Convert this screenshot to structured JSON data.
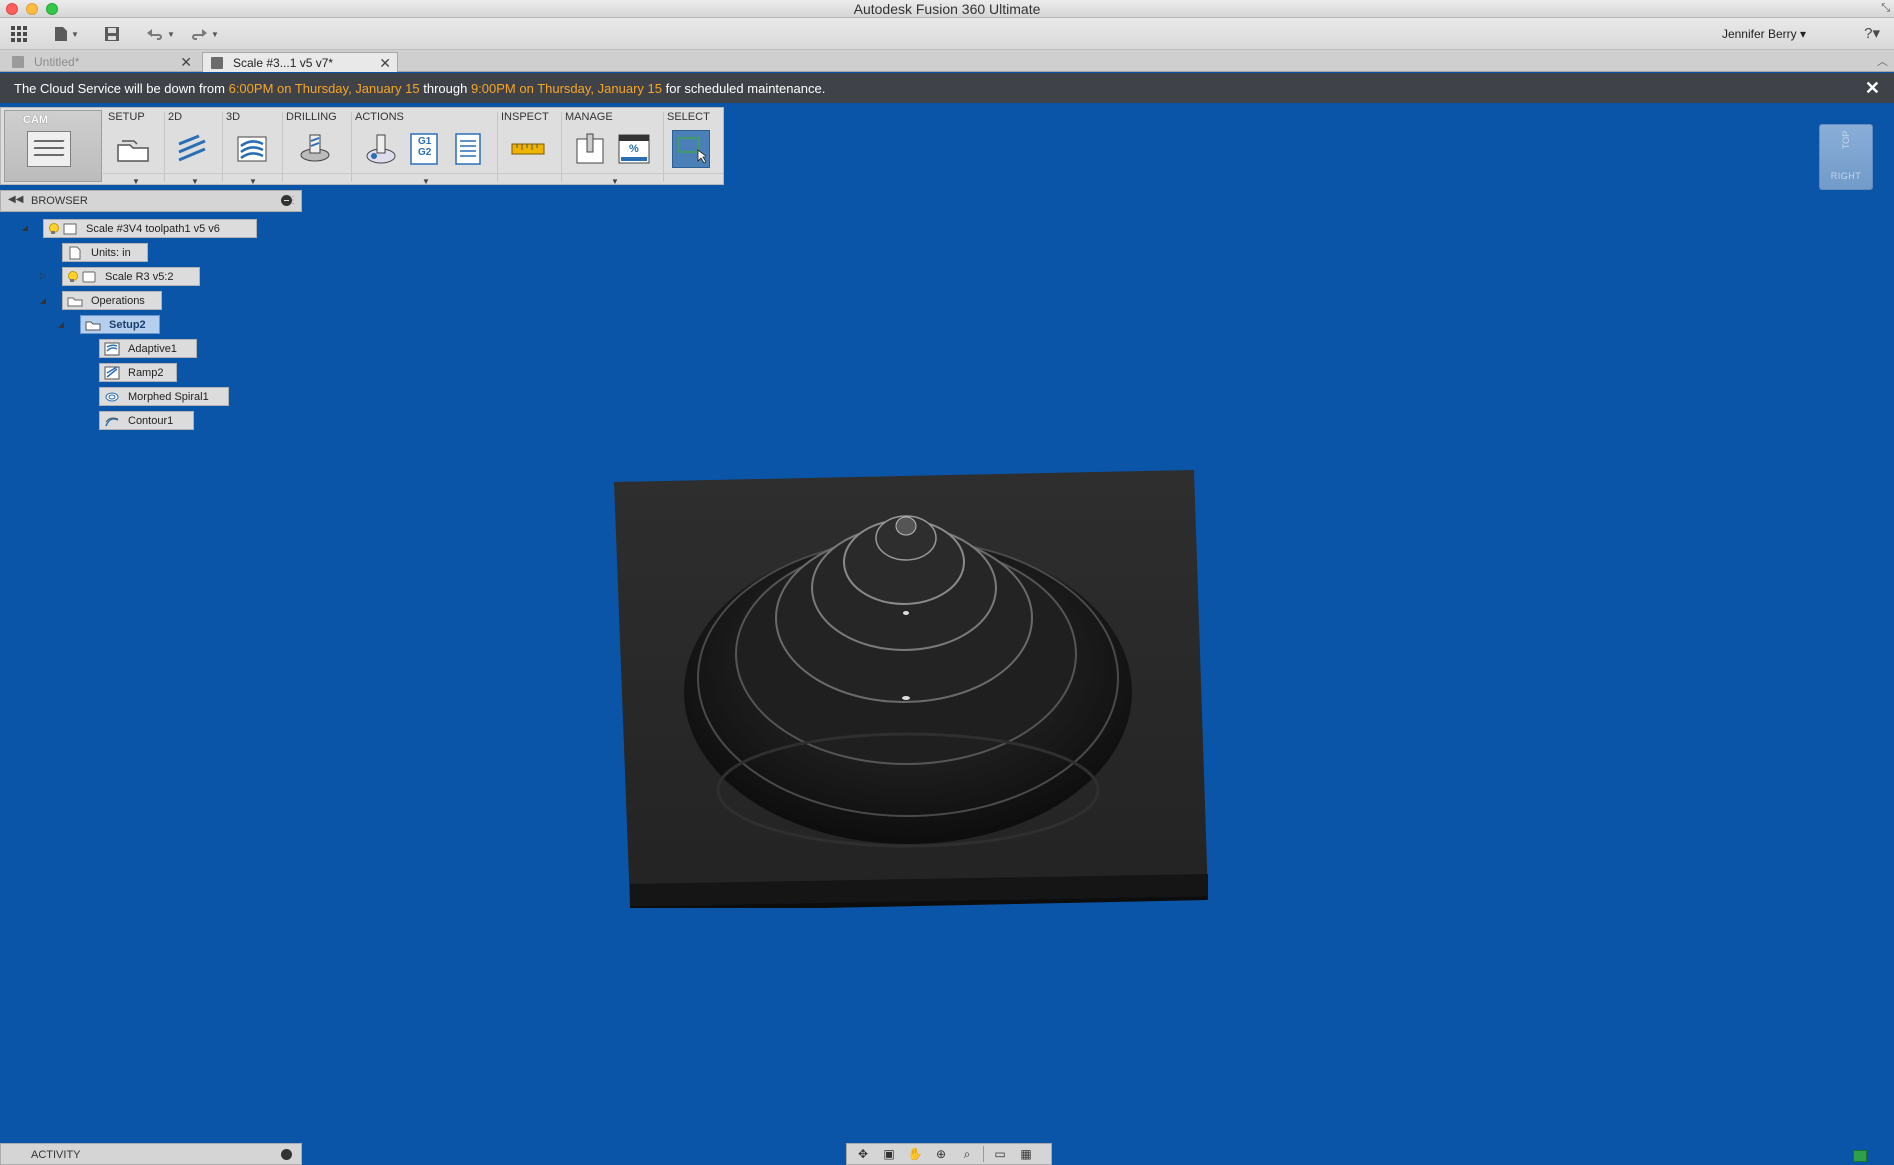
{
  "window": {
    "title": "Autodesk Fusion 360 Ultimate"
  },
  "app_toolbar": {
    "user": "Jennifer Berry ▾",
    "help": "?▾"
  },
  "tabs": [
    {
      "label": "Untitled*",
      "close": "✕"
    },
    {
      "label": "Scale #3...1 v5 v7*",
      "close": "✕"
    }
  ],
  "banner": {
    "prefix": "The Cloud Service will be down from ",
    "start": "6:00PM on Thursday, January 15",
    "middle": " through ",
    "end": "9:00PM on Thursday, January 15",
    "suffix": " for scheduled maintenance.",
    "close": "✕",
    "highlight_color": "#f6a523"
  },
  "ribbon": {
    "workspace": "CAM",
    "groups": [
      "SETUP",
      "2D",
      "3D",
      "DRILLING",
      "ACTIONS",
      "INSPECT",
      "MANAGE",
      "SELECT"
    ],
    "g1g2_top": "G1",
    "g1g2_bottom": "G2",
    "percent": "%"
  },
  "viewcube": {
    "face": "RIGHT",
    "top": "TOP"
  },
  "browser": {
    "title": "BROWSER",
    "root": "Scale #3V4 toolpath1 v5 v6",
    "units": "Units: in",
    "component": "Scale R3 v5:2",
    "operations": "Operations",
    "setup": "Setup2",
    "ops": [
      "Adaptive1",
      "Ramp2",
      "Morphed Spiral1",
      "Contour1"
    ]
  },
  "activity": {
    "title": "ACTIVITY"
  },
  "colors": {
    "viewport_bg": "#0a55a8",
    "selection": "#b5cfed",
    "ribbon_active": "#4a7fb8"
  }
}
